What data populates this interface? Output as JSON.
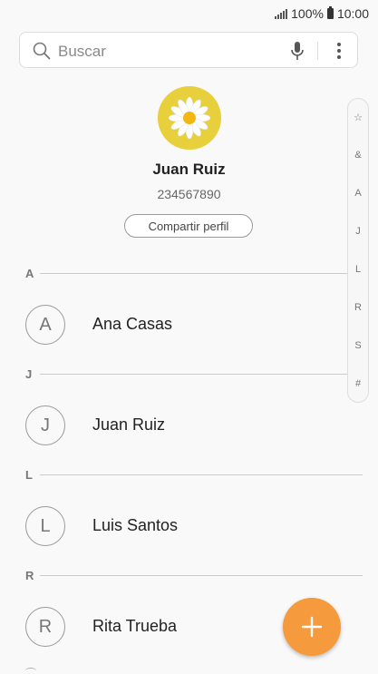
{
  "status_bar": {
    "battery_text": "100%",
    "time": "10:00",
    "icons": [
      "signal-icon",
      "battery-icon"
    ]
  },
  "search": {
    "placeholder": "Buscar",
    "icons": [
      "search-icon",
      "mic-icon",
      "more-vertical-icon"
    ]
  },
  "profile": {
    "name": "Juan Ruiz",
    "phone": "234567890",
    "share_label": "Compartir perfil",
    "avatar_icon": "daisy-flower-icon",
    "avatar_color": "#e8cf3c"
  },
  "sections": [
    {
      "letter": "A",
      "contacts": [
        {
          "initial": "A",
          "name": "Ana Casas"
        }
      ]
    },
    {
      "letter": "J",
      "contacts": [
        {
          "initial": "J",
          "name": "Juan Ruiz"
        }
      ]
    },
    {
      "letter": "L",
      "contacts": [
        {
          "initial": "L",
          "name": "Luis Santos"
        }
      ]
    },
    {
      "letter": "R",
      "contacts": [
        {
          "initial": "R",
          "name": "Rita Trueba"
        }
      ]
    }
  ],
  "index_scroller": [
    "☆",
    "&",
    "A",
    "J",
    "L",
    "R",
    "S",
    "#"
  ],
  "fab": {
    "icon": "plus-icon",
    "color": "#f59b3d"
  }
}
